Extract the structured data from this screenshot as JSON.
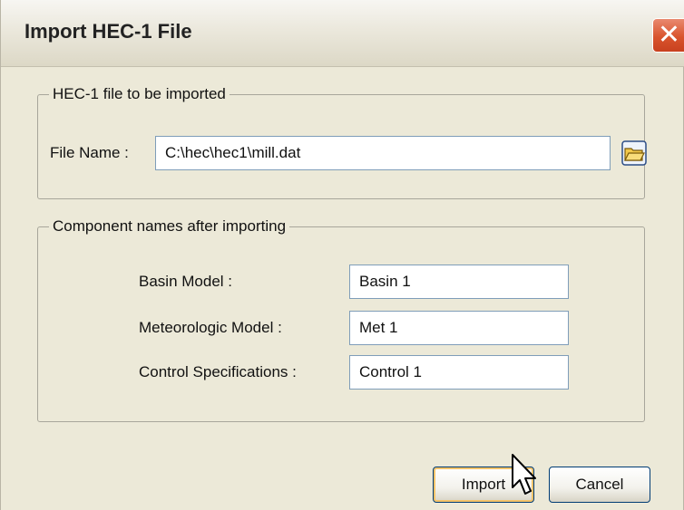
{
  "window": {
    "title": "Import HEC-1 File",
    "close_icon": "close-icon"
  },
  "file_group": {
    "legend": "HEC-1 file to be imported",
    "file_name_label": "File Name :",
    "file_name_value": "C:\\hec\\hec1\\mill.dat",
    "browse_icon": "folder-open-icon"
  },
  "names_group": {
    "legend": "Component names after importing",
    "basin_label": "Basin Model :",
    "basin_value": "Basin 1",
    "met_label": "Meteorologic Model :",
    "met_value": "Met 1",
    "control_label": "Control Specifications :",
    "control_value": "Control 1"
  },
  "buttons": {
    "import_label": "Import",
    "cancel_label": "Cancel"
  },
  "colors": {
    "window_bg": "#ece9d8",
    "close_button": "#d9542d",
    "default_button_highlight": "#f4c36a"
  }
}
